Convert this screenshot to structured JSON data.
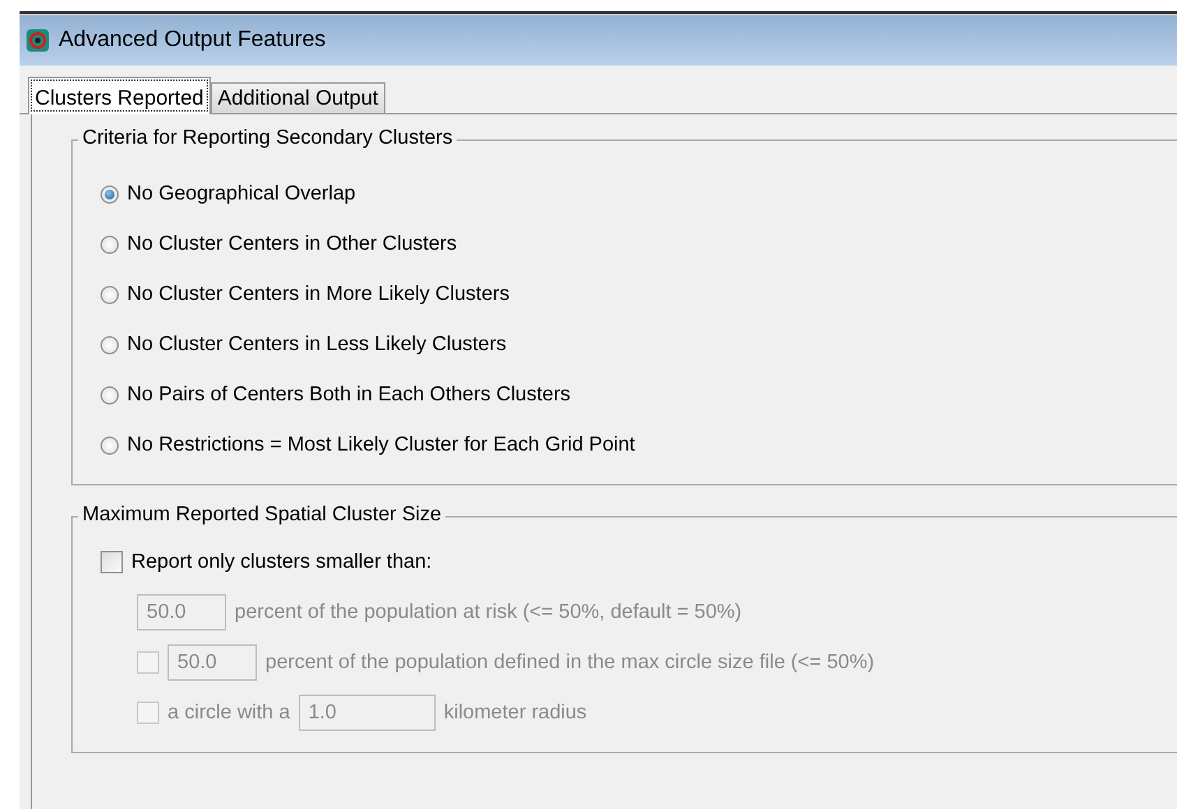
{
  "window": {
    "title": "Advanced Output Features"
  },
  "tabs": [
    {
      "label": "Clusters Reported",
      "selected": true
    },
    {
      "label": "Additional Output",
      "selected": false
    }
  ],
  "criteria_group": {
    "title": "Criteria for Reporting Secondary Clusters",
    "options": [
      {
        "label": "No Geographical Overlap",
        "selected": true
      },
      {
        "label": "No Cluster Centers in Other Clusters",
        "selected": false
      },
      {
        "label": "No Cluster Centers in More Likely Clusters",
        "selected": false
      },
      {
        "label": "No Cluster Centers in Less Likely Clusters",
        "selected": false
      },
      {
        "label": "No Pairs of Centers Both in Each Others Clusters",
        "selected": false
      },
      {
        "label": "No Restrictions = Most Likely Cluster for Each Grid Point",
        "selected": false
      }
    ]
  },
  "size_group": {
    "title": "Maximum Reported Spatial Cluster Size",
    "report_only": {
      "label": "Report only clusters smaller than:",
      "checked": false
    },
    "limits": [
      {
        "kind": "field",
        "value": "50.0",
        "suffix": "percent of the population at risk (<= 50%, default = 50%)",
        "disabled": true
      },
      {
        "kind": "check-field",
        "checked": false,
        "value": "50.0",
        "suffix": "percent of the population defined in the max circle size file (<= 50%)",
        "disabled": true
      },
      {
        "kind": "check-field",
        "checked": false,
        "prefix": "a circle with a",
        "value": "1.0",
        "suffix": "kilometer radius",
        "disabled": true
      }
    ]
  }
}
